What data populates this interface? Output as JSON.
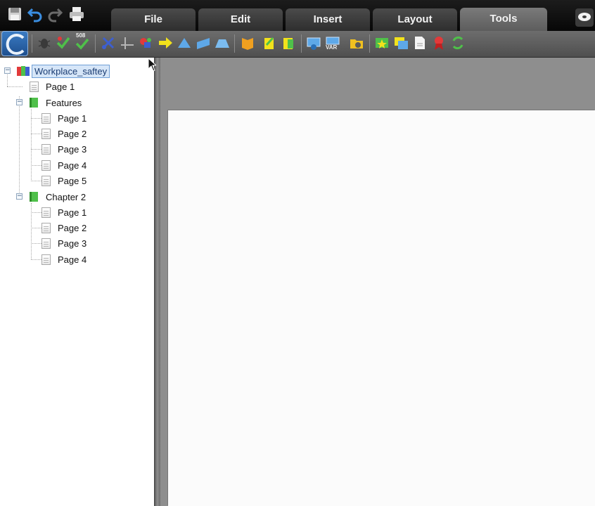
{
  "menu": {
    "tabs": [
      {
        "label": "File"
      },
      {
        "label": "Edit"
      },
      {
        "label": "Insert"
      },
      {
        "label": "Layout"
      },
      {
        "label": "Tools",
        "active": true
      }
    ]
  },
  "tree": {
    "root": {
      "label": "Workplace_saftey",
      "selected": true
    },
    "items": [
      {
        "label": "Page 1"
      },
      {
        "label": "Features"
      },
      {
        "label": "Page 1"
      },
      {
        "label": "Page 2"
      },
      {
        "label": "Page 3"
      },
      {
        "label": "Page 4"
      },
      {
        "label": "Page 5"
      },
      {
        "label": "Chapter 2"
      },
      {
        "label": "Page 1"
      },
      {
        "label": "Page 2"
      },
      {
        "label": "Page 3"
      },
      {
        "label": "Page 4"
      }
    ]
  },
  "toolbar": {
    "var_badge": "VAR",
    "num_badge": "508"
  },
  "colors": {
    "menubar": "#0b0b0b",
    "tab": "#3a3a3a",
    "tab_active": "#6a6a6a",
    "toolbar": "#5e5e5e",
    "canvas_bg": "#8e8e8e",
    "selection": "#d6e6f8"
  }
}
